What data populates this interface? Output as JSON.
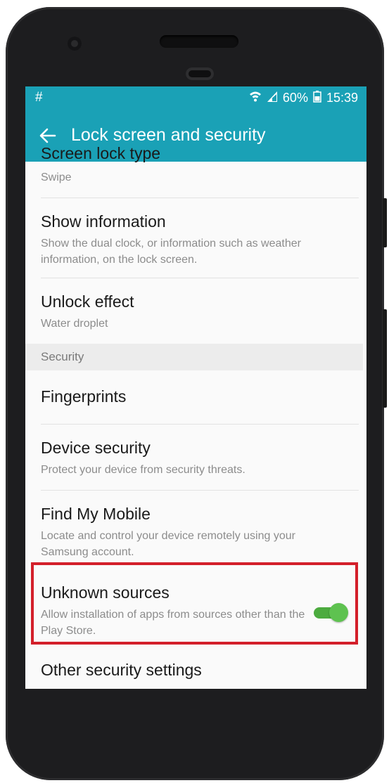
{
  "status_bar": {
    "left_glyph": "#",
    "battery": "60%",
    "time": "15:39",
    "icons": [
      "wifi-icon",
      "signal-icon",
      "battery-icon"
    ]
  },
  "app_bar": {
    "title": "Lock screen and security",
    "back_icon": "arrow-left-icon"
  },
  "settings": {
    "screen_lock_type": {
      "title": "Screen lock type",
      "summary": "Swipe"
    },
    "show_information": {
      "title": "Show information",
      "summary": "Show the dual clock, or information such as weather information, on the lock screen."
    },
    "unlock_effect": {
      "title": "Unlock effect",
      "summary": "Water droplet"
    },
    "security_header": "Security",
    "fingerprints": {
      "title": "Fingerprints"
    },
    "device_security": {
      "title": "Device security",
      "summary": "Protect your device from security threats."
    },
    "find_my_mobile": {
      "title": "Find My Mobile",
      "summary": "Locate and control your device remotely using your Samsung account."
    },
    "unknown_sources": {
      "title": "Unknown sources",
      "summary": "Allow installation of apps from sources other than the Play Store.",
      "enabled": true
    },
    "other_security": {
      "title": "Other security settings"
    }
  },
  "colors": {
    "accent": "#1aa1b6",
    "toggle_on": "#5ec250",
    "highlight": "#d31f2a"
  }
}
